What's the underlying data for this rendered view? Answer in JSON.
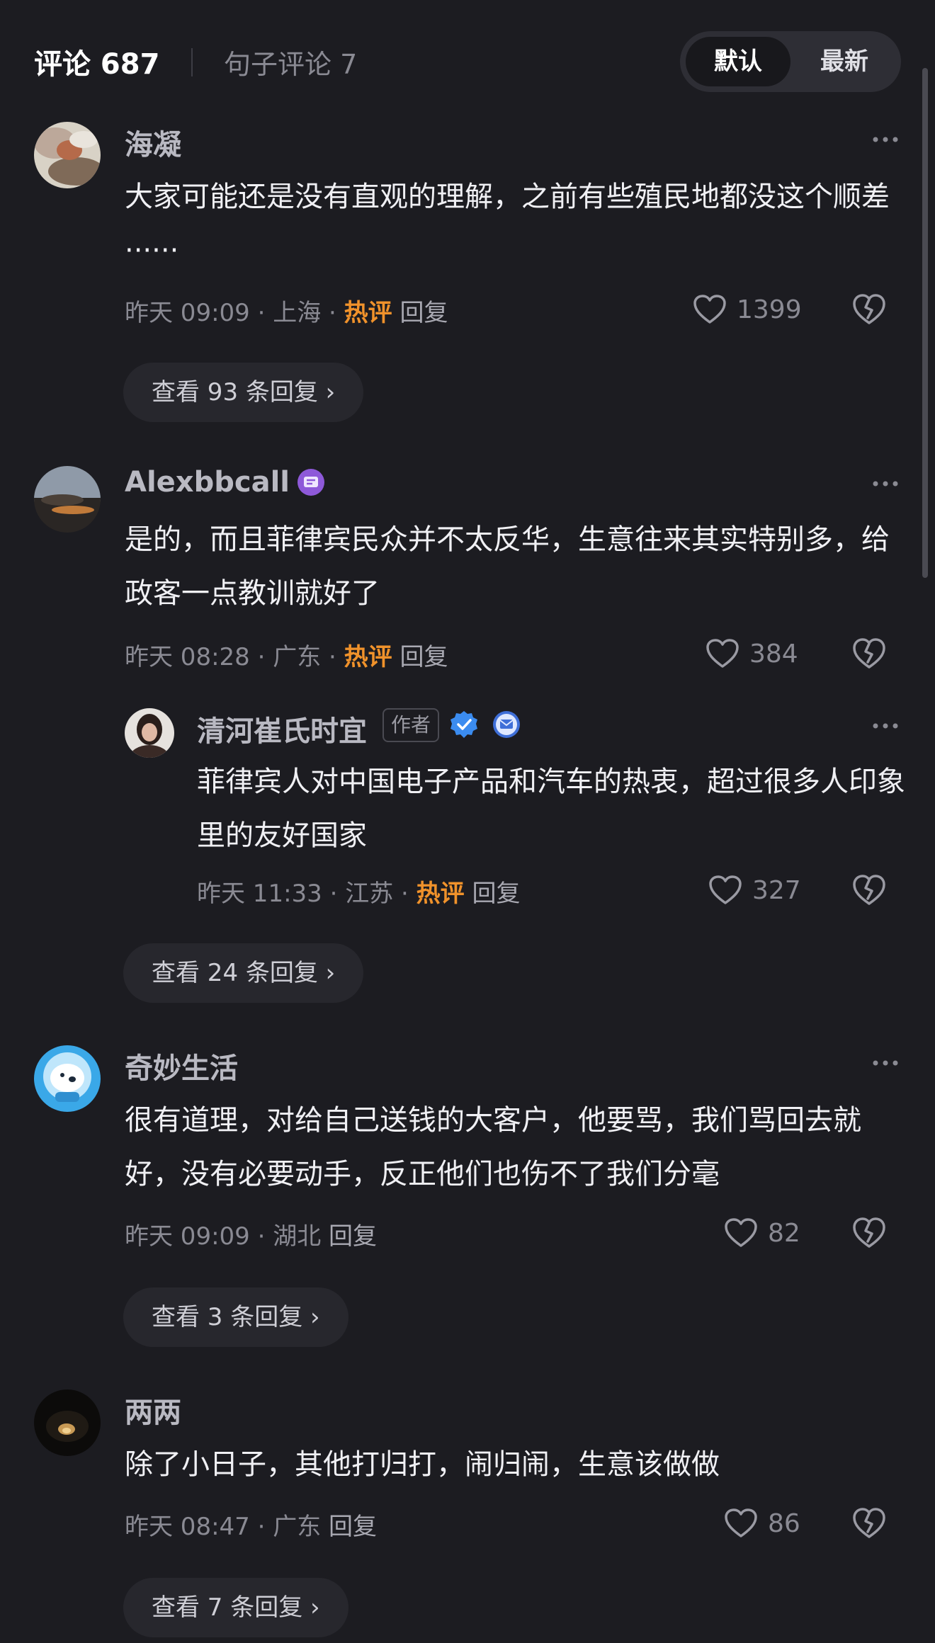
{
  "header": {
    "comments_tab": "评论 687",
    "sentence_tab": "句子评论 7",
    "sort_default": "默认",
    "sort_latest": "最新"
  },
  "comments": [
    {
      "user": "海凝",
      "text": "大家可能还是没有直观的理解，之前有些殖民地都没这个顺差······",
      "time": "昨天 09:09",
      "location": "上海",
      "hot": "热评",
      "reply": "回复",
      "likes": "1399",
      "view_replies": "查看 93 条回复 ›"
    },
    {
      "user": "Alexbbcall",
      "text": "是的，而且菲律宾民众并不太反华，生意往来其实特别多，给政客一点教训就好了",
      "time": "昨天 08:28",
      "location": "广东",
      "hot": "热评",
      "reply": "回复",
      "likes": "384",
      "sub": {
        "user": "清河崔氏时宜",
        "author_badge": "作者",
        "text": "菲律宾人对中国电子产品和汽车的热衷，超过很多人印象里的友好国家",
        "time": "昨天 11:33",
        "location": "江苏",
        "hot": "热评",
        "reply": "回复",
        "likes": "327"
      },
      "view_replies": "查看 24 条回复 ›"
    },
    {
      "user": "奇妙生活",
      "text": "很有道理，对给自己送钱的大客户，他要骂，我们骂回去就好，没有必要动手，反正他们也伤不了我们分毫",
      "time": "昨天 09:09",
      "location": "湖北",
      "reply": "回复",
      "likes": "82",
      "view_replies": "查看 3 条回复 ›"
    },
    {
      "user": "两两",
      "text": "除了小日子，其他打归打，闹归闹，生意该做做",
      "time": "昨天 08:47",
      "location": "广东",
      "reply": "回复",
      "likes": "86",
      "view_replies": "查看 7 条回复 ›"
    }
  ],
  "meta_separator": " · ",
  "colors": {
    "background": "#1c1c21",
    "hot": "#f0922b",
    "verified": "#3b8cf0",
    "vip_badge": "#8e59d9"
  },
  "icons": [
    "more-icon",
    "heart-icon",
    "dislike-icon",
    "verified-icon",
    "vip-badge-icon",
    "message-badge-icon"
  ]
}
